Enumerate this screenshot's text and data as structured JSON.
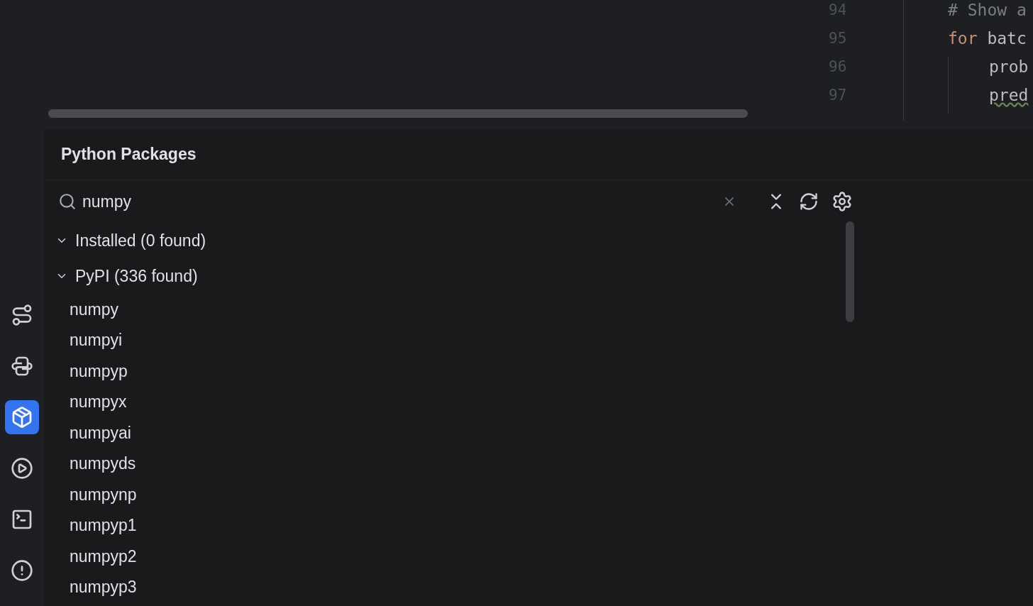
{
  "tool_strip": [
    {
      "selected": false
    },
    {
      "selected": false
    },
    {
      "selected": true
    },
    {
      "selected": false
    },
    {
      "selected": false
    },
    {
      "selected": false
    }
  ],
  "editor": {
    "lines": [
      {
        "number": "94",
        "indented": false,
        "warning": false,
        "tokens": [
          {
            "kind": "comment",
            "text": "# Show a"
          }
        ]
      },
      {
        "number": "95",
        "indented": false,
        "warning": false,
        "tokens": [
          {
            "kind": "keyword",
            "text": "for"
          },
          {
            "kind": "plain",
            "text": " batc"
          }
        ]
      },
      {
        "number": "96",
        "indented": true,
        "warning": false,
        "tokens": [
          {
            "kind": "plain",
            "text": "prob"
          }
        ]
      },
      {
        "number": "97",
        "indented": true,
        "warning": true,
        "tokens": [
          {
            "kind": "plain",
            "text": "pred"
          }
        ]
      }
    ]
  },
  "packages": {
    "title": "Python Packages",
    "search": {
      "value": "numpy"
    },
    "groups": [
      {
        "label": "Installed (0 found)",
        "expanded": true
      },
      {
        "label": "PyPI (336 found)",
        "expanded": true,
        "children": [
          {
            "label": "numpy"
          },
          {
            "label": "numpyi"
          },
          {
            "label": "numpyp"
          },
          {
            "label": "numpyx"
          },
          {
            "label": "numpyai"
          },
          {
            "label": "numpyds"
          },
          {
            "label": "numpynp"
          },
          {
            "label": "numpyp1"
          },
          {
            "label": "numpyp2"
          },
          {
            "label": "numpyp3"
          }
        ]
      }
    ]
  }
}
